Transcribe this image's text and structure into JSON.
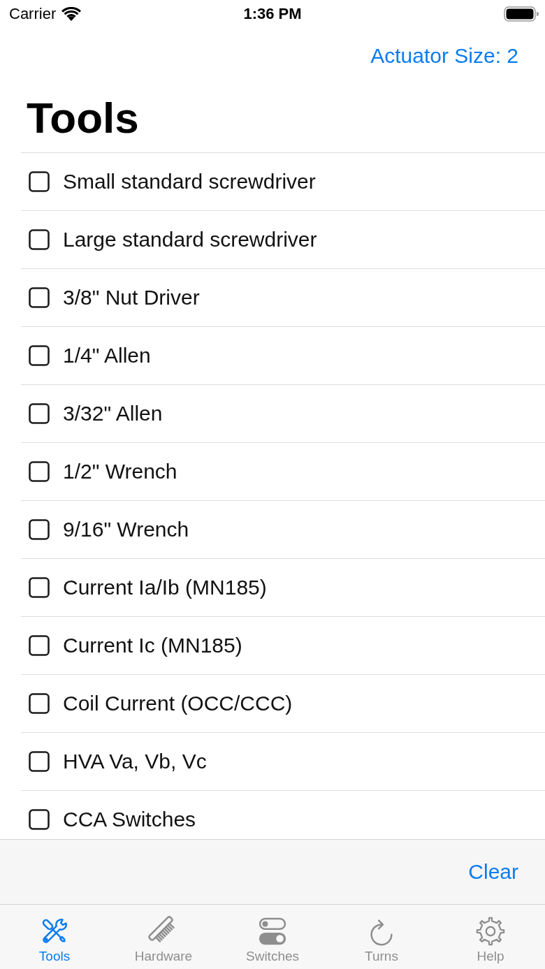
{
  "status_bar": {
    "carrier": "Carrier",
    "time": "1:36 PM"
  },
  "nav_bar": {
    "button": "Actuator Size: 2"
  },
  "title": "Tools",
  "items": [
    {
      "label": "Small standard screwdriver",
      "checked": false
    },
    {
      "label": "Large standard screwdriver",
      "checked": false
    },
    {
      "label": "3/8\" Nut Driver",
      "checked": false
    },
    {
      "label": "1/4\" Allen",
      "checked": false
    },
    {
      "label": "3/32\" Allen",
      "checked": false
    },
    {
      "label": "1/2\" Wrench",
      "checked": false
    },
    {
      "label": "9/16\" Wrench",
      "checked": false
    },
    {
      "label": "Current Ia/Ib (MN185)",
      "checked": false
    },
    {
      "label": "Current Ic (MN185)",
      "checked": false
    },
    {
      "label": "Coil Current (OCC/CCC)",
      "checked": false
    },
    {
      "label": "HVA Va, Vb, Vc",
      "checked": false
    },
    {
      "label": "CCA Switches",
      "checked": false
    }
  ],
  "toolbar": {
    "button": "Clear"
  },
  "tabs": [
    {
      "label": "Tools",
      "selected": true
    },
    {
      "label": "Hardware",
      "selected": false
    },
    {
      "label": "Switches",
      "selected": false
    },
    {
      "label": "Turns",
      "selected": false
    },
    {
      "label": "Help",
      "selected": false
    }
  ]
}
